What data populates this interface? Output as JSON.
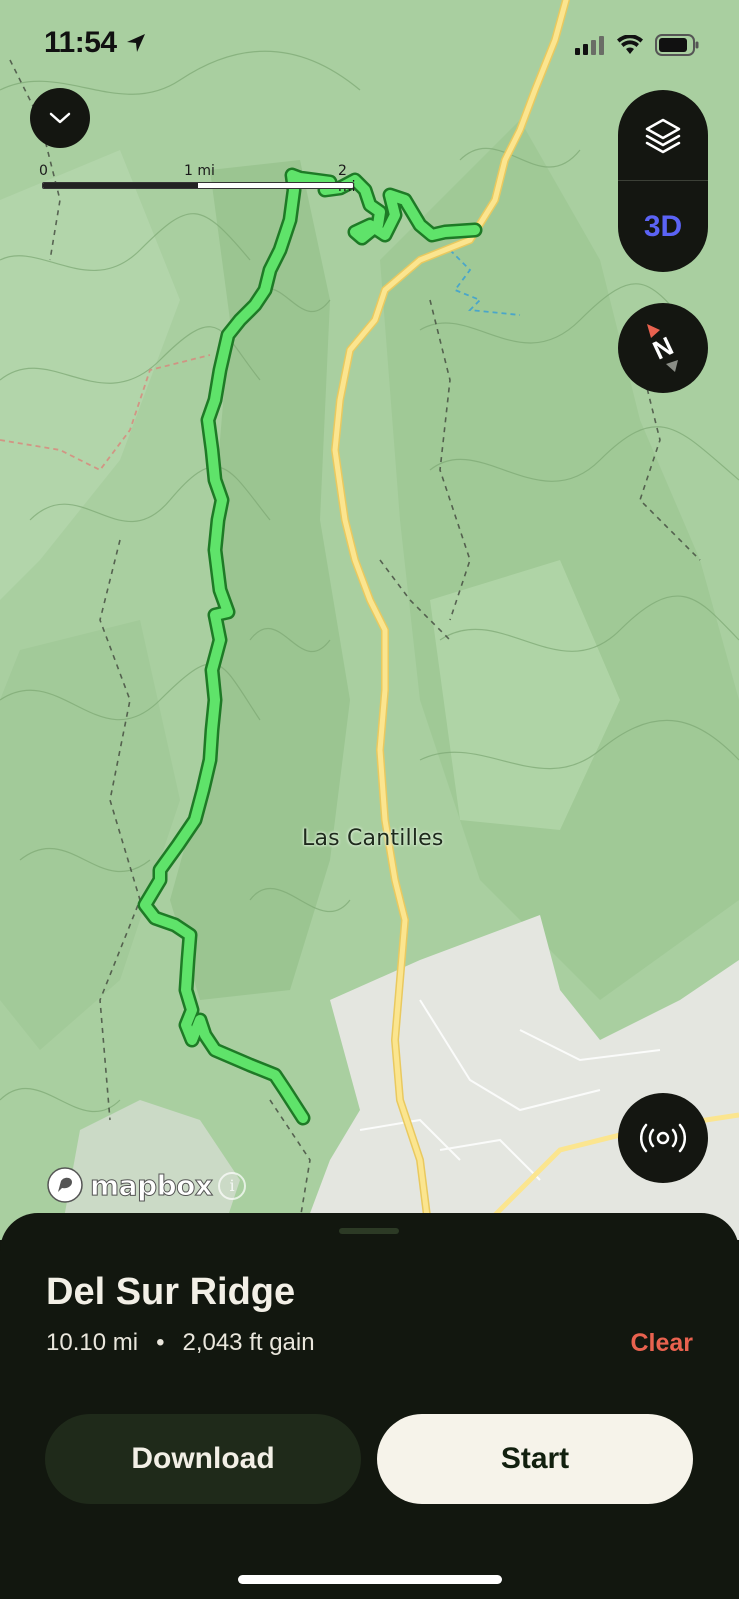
{
  "status_bar": {
    "time": "11:54",
    "location_icon": "location-arrow-icon",
    "signal_icon": "cellular-signal-icon",
    "wifi_icon": "wifi-icon",
    "battery_icon": "battery-icon"
  },
  "map": {
    "scale_labels": [
      "0",
      "1 mi",
      "2 mi"
    ],
    "place_label": "Las Cantilles",
    "attribution": "mapbox",
    "info_symbol": "i",
    "layers_icon": "layers-icon",
    "mode_3d_label": "3D",
    "compass_letter": "N",
    "broadcast_icon": "broadcast-icon",
    "collapse_icon": "chevron-down-icon",
    "colors": {
      "terrain": "#a9cfa0",
      "urban": "#e6e8e2",
      "road": "#f5dc7a",
      "route": "#5fe36a",
      "route_outline": "#1e7a26",
      "stream": "#4aa6c9"
    }
  },
  "route": {
    "name": "Del Sur Ridge",
    "distance": "10.10 mi",
    "separator": "•",
    "gain": "2,043 ft gain",
    "clear_label": "Clear",
    "download_label": "Download",
    "start_label": "Start"
  }
}
